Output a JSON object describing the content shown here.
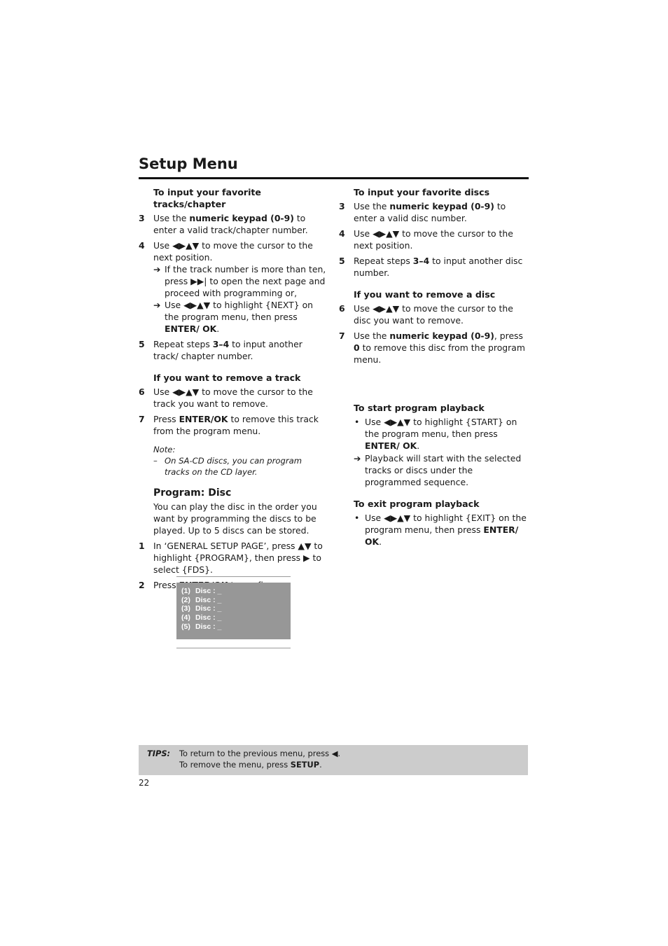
{
  "header": {
    "title": "Setup Menu"
  },
  "left": {
    "tracks_heading": "To input your favorite tracks/chapter",
    "step3": {
      "num": "3",
      "pre": "Use the ",
      "bold": "numeric keypad (0-9)",
      "post": " to enter a valid track/chapter number."
    },
    "step4": {
      "num": "4",
      "text": "Use ◀▶▲▼ to move the cursor to the next position.",
      "arrow1": "If the track number is more than ten, press ▶▶| to open the next page and proceed with programming or,",
      "arrow2_pre": "Use ◀▶▲▼ to highlight {NEXT} on the program menu, then press ",
      "arrow2_bold": "ENTER/ OK",
      "arrow2_post": "."
    },
    "step5": {
      "num": "5",
      "pre": "Repeat steps ",
      "bold": "3–4",
      "post": " to input another track/ chapter number."
    },
    "remove_heading": "If you want to remove a track",
    "step6": {
      "num": "6",
      "text": "Use ◀▶▲▼ to move the cursor to the track you want to remove."
    },
    "step7": {
      "num": "7",
      "pre": "Press ",
      "bold": "ENTER/OK",
      "post": " to remove this track from the program menu."
    },
    "note_label": "Note:",
    "note_dash": "–",
    "note_text": "On SA-CD discs, you can program tracks on the CD layer.",
    "disc_heading": "Program: Disc",
    "disc_intro": "You can play the disc in the order you want by programming the discs to be played. Up to 5 discs can be stored.",
    "d_step1": {
      "num": "1",
      "text": "In ‘GENERAL SETUP PAGE’, press ▲▼ to highlight {PROGRAM}, then press ▶ to select {FDS}."
    },
    "d_step2": {
      "num": "2",
      "pre": "Press ",
      "bold": "ENTER/OK",
      "post": " to confirm."
    }
  },
  "screen": {
    "rows": [
      {
        "idx": "(1)",
        "label": "Disc : _"
      },
      {
        "idx": "(2)",
        "label": "Disc : _"
      },
      {
        "idx": "(3)",
        "label": "Disc : _"
      },
      {
        "idx": "(4)",
        "label": "Disc : _"
      },
      {
        "idx": "(5)",
        "label": "Disc : _"
      }
    ],
    "bg_color": "#979797"
  },
  "right": {
    "discs_heading": "To input your favorite discs",
    "step3": {
      "num": "3",
      "pre": "Use the ",
      "bold": "numeric keypad (0-9)",
      "post": " to enter a valid disc number."
    },
    "step4": {
      "num": "4",
      "text": "Use ◀▶▲▼ to move the cursor to the next position."
    },
    "step5": {
      "num": "5",
      "pre": "Repeat steps ",
      "bold": "3–4",
      "post": " to input another disc number."
    },
    "remove_heading": "If you want to remove a disc",
    "step6": {
      "num": "6",
      "text": "Use ◀▶▲▼ to move the cursor to the disc you want to remove."
    },
    "step7": {
      "num": "7",
      "pre": "Use the ",
      "bold": "numeric keypad (0-9)",
      "mid": ", press ",
      "bold2": "0",
      "post": " to remove this disc from the program menu."
    },
    "start_heading": "To start program playback",
    "start_bullet_pre": "Use ◀▶▲▼ to highlight {START} on the program menu, then press ",
    "start_bullet_bold": "ENTER/ OK",
    "start_bullet_post": ".",
    "start_arrow": "Playback will start with the selected tracks or discs under the programmed sequence.",
    "exit_heading": "To exit program playback",
    "exit_bullet_pre": "Use ◀▶▲▼ to highlight {EXIT} on the program menu, then press ",
    "exit_bullet_bold": "ENTER/ OK",
    "exit_bullet_post": "."
  },
  "glyphs": {
    "arrow": "➔",
    "bullet": "•"
  },
  "tips": {
    "label": "TIPS:",
    "line1": "To return to the previous menu, press ◀.",
    "line2_pre": "To remove the menu, press ",
    "line2_bold": "SETUP",
    "line2_post": ".",
    "bg_color": "#cccccc"
  },
  "footer": {
    "page_number": "22"
  }
}
